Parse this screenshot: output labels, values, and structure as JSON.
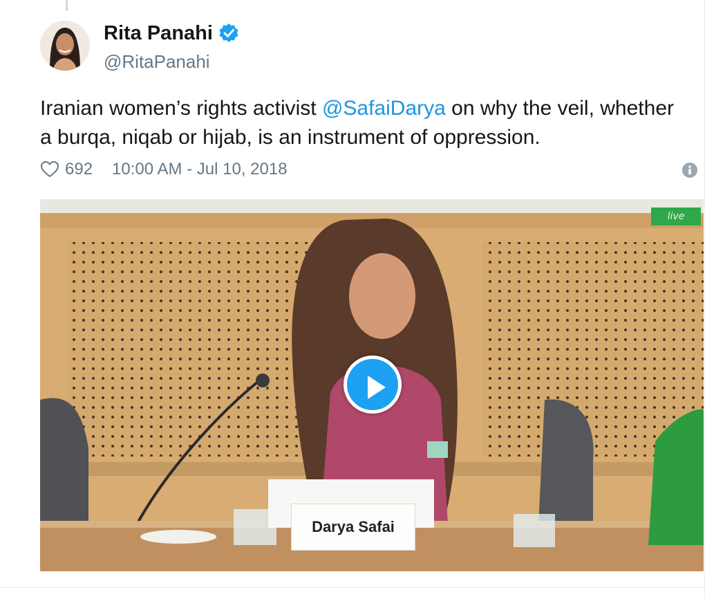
{
  "user": {
    "display_name": "Rita Panahi",
    "handle": "@RitaPanahi",
    "verified": true,
    "avatar_icon": "profile-photo"
  },
  "tweet": {
    "text_part1": "Iranian women’s rights activist ",
    "mention": "@SafaiDarya",
    "text_part2": " on why the veil, whether a burqa, niqab or hijab, is an instrument of oppression."
  },
  "meta": {
    "like_count": "692",
    "timestamp": "10:00 AM - Jul 10, 2018",
    "heart_icon": "heart-outline-icon",
    "info_icon": "info-circle-icon"
  },
  "media": {
    "live_label": "live",
    "nameplate": "Darya Safai",
    "play_icon": "play-icon"
  },
  "colors": {
    "link": "#1b95e0",
    "secondary_text": "#657786",
    "play_button": "#1da1f2",
    "verified_badge": "#1da1f2",
    "live_badge": "#2ea84a"
  }
}
